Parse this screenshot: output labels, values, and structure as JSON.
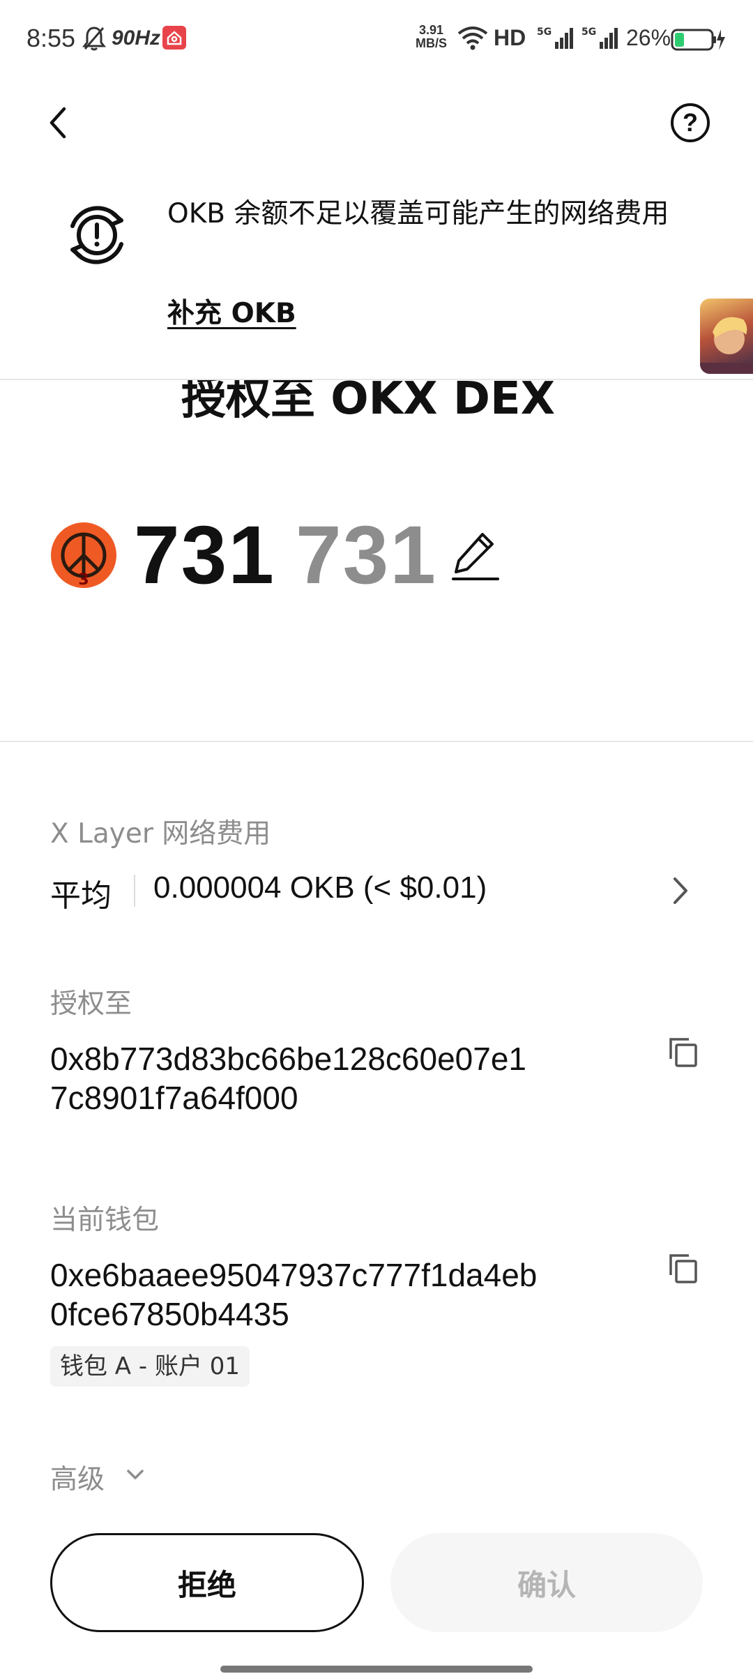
{
  "status_bar": {
    "time": "8:55",
    "refresh_rate": "90Hz",
    "net_speed_value": "3.91",
    "net_speed_unit": "MB/S",
    "network_label": "HD",
    "battery_percent": "26%",
    "battery_level": 0.26,
    "battery_color": "#2ecc71"
  },
  "header": {
    "back_icon": "chevron-left-icon",
    "help_icon": "question-circle-icon",
    "help_text": "?"
  },
  "warning": {
    "icon": "refresh-alert-icon",
    "message": "OKB 余额不足以覆盖可能产生的网络费用",
    "link_label": "补充 OKB"
  },
  "approval": {
    "title_partial": "授权至 OKX DEX",
    "token_icon_text": "3",
    "token_icon_color": "#ef5a24",
    "amount": "731",
    "amount_ghost": "731",
    "edit_icon": "pencil-icon"
  },
  "network_fee": {
    "label": "X Layer 网络费用",
    "level": "平均",
    "value": "0.000004 OKB (< $0.01)"
  },
  "spender": {
    "label": "授权至",
    "address": "0x8b773d83bc66be128c60e07e17c8901f7a64f000",
    "address_line1": "0x8b773d83bc66be128c60e07e1",
    "address_line2": "7c8901f7a64f000"
  },
  "wallet": {
    "label": "当前钱包",
    "address": "0xe6baaee95047937c777f1da4eb0fce67850b4435",
    "address_line1": "0xe6baaee95047937c777f1da4eb",
    "address_line2": "0fce67850b4435",
    "account": "钱包 A - 账户 01"
  },
  "advanced": {
    "label": "高级"
  },
  "actions": {
    "reject": "拒绝",
    "confirm": "确认"
  }
}
